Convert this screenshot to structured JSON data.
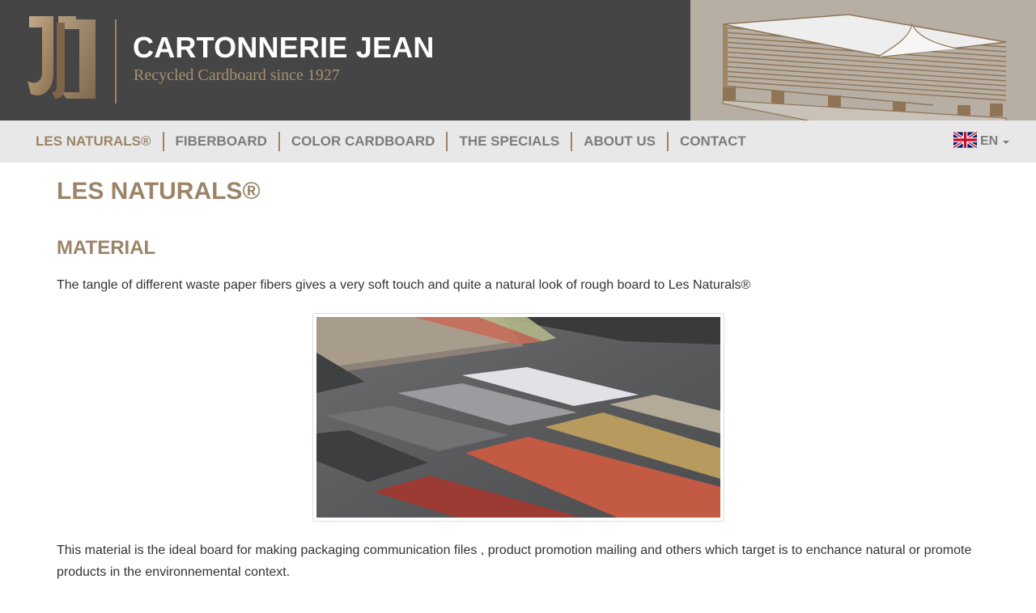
{
  "brand": {
    "title": "CARTONNERIE JEAN",
    "tagline": "Recycled Cardboard since 1927"
  },
  "nav": {
    "items": [
      {
        "label": "LES NATURALS®",
        "active": true
      },
      {
        "label": "FIBERBOARD",
        "active": false
      },
      {
        "label": "COLOR CARDBOARD",
        "active": false
      },
      {
        "label": "THE SPECIALS",
        "active": false
      },
      {
        "label": "ABOUT US",
        "active": false
      },
      {
        "label": "CONTACT",
        "active": false
      }
    ],
    "language": {
      "code": "EN",
      "icon": "uk-flag-icon"
    }
  },
  "content": {
    "page_title": "LES NATURALS®",
    "section_title": "MATERIAL",
    "intro": "The tangle of different waste paper fibers gives a very soft touch and quite a natural look of rough board to Les Naturals®",
    "body": "This material is the ideal board for making packaging communication files , product promotion mailing and others which target is to enchance natural or promote products in the environnemental context."
  },
  "colors": {
    "accent": "#9c8468",
    "header_bg": "#454545",
    "nav_bg": "#e8e8e8",
    "nav_text": "#7c7c7c"
  }
}
